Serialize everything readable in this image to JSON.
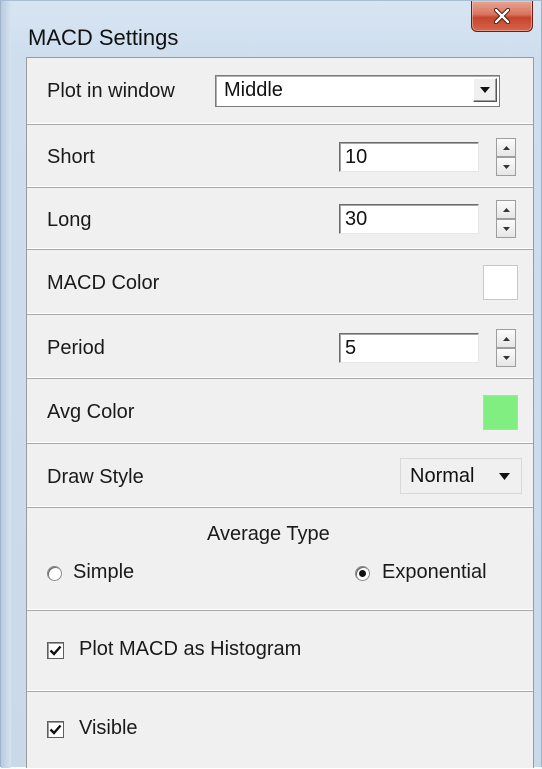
{
  "window": {
    "title": "MACD Settings",
    "close_icon": "close-x-icon"
  },
  "plot_in_window": {
    "label": "Plot in window",
    "selected": "Middle"
  },
  "short": {
    "label": "Short",
    "value": "10"
  },
  "long": {
    "label": "Long",
    "value": "30"
  },
  "macd_color": {
    "label": "MACD Color",
    "color": "#ffffff"
  },
  "period": {
    "label": "Period",
    "value": "5"
  },
  "avg_color": {
    "label": "Avg Color",
    "color": "#80ee80"
  },
  "draw_style": {
    "label": "Draw Style",
    "selected": "Normal"
  },
  "average_type": {
    "title": "Average Type",
    "options": [
      {
        "label": "Simple",
        "selected": false
      },
      {
        "label": "Exponential",
        "selected": true
      }
    ]
  },
  "plot_histogram": {
    "label": "Plot MACD as Histogram",
    "checked": true
  },
  "visible": {
    "label": "Visible",
    "checked": true
  }
}
